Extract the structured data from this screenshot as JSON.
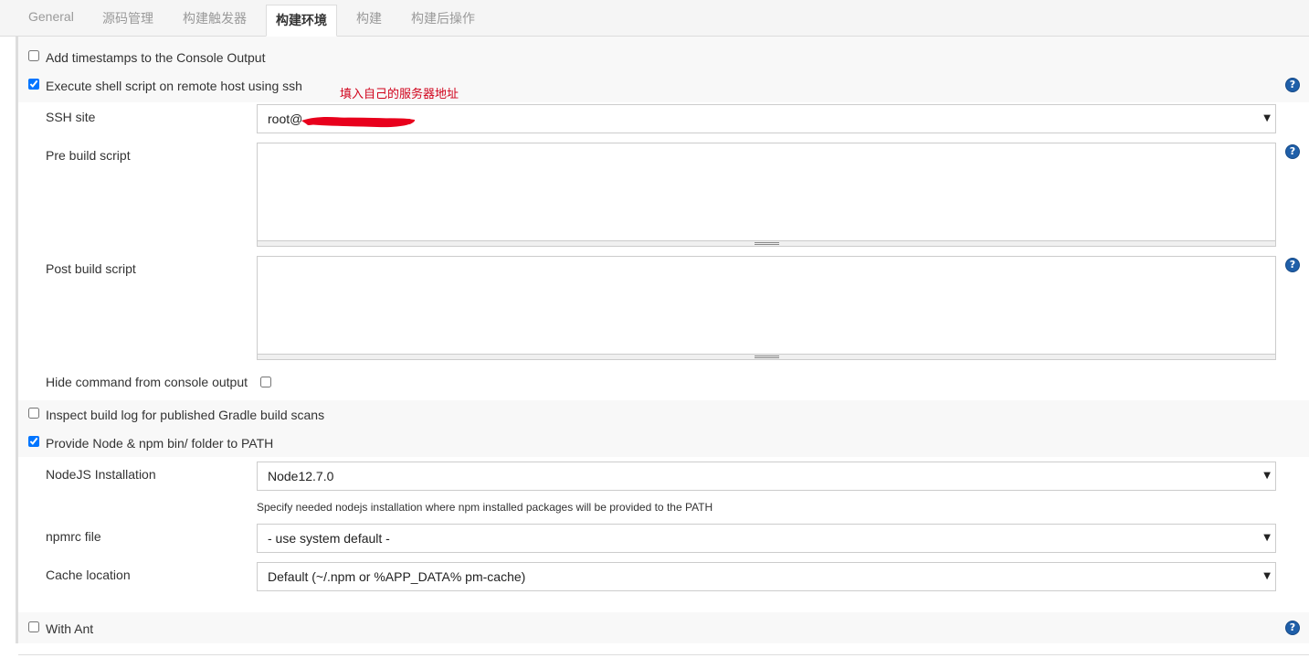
{
  "tabs": [
    {
      "label": "General",
      "active": false
    },
    {
      "label": "源码管理",
      "active": false
    },
    {
      "label": "构建触发器",
      "active": false
    },
    {
      "label": "构建环境",
      "active": true
    },
    {
      "label": "构建",
      "active": false
    },
    {
      "label": "构建后操作",
      "active": false
    }
  ],
  "options": {
    "timestamps": {
      "label": "Add timestamps to the Console Output",
      "checked": false
    },
    "ssh": {
      "label": "Execute shell script on remote host using ssh",
      "checked": true
    },
    "gradle": {
      "label": "Inspect build log for published Gradle build scans",
      "checked": false
    },
    "node": {
      "label": "Provide Node & npm bin/ folder to PATH",
      "checked": true
    },
    "ant": {
      "label": "With Ant",
      "checked": false
    }
  },
  "annotation": "填入自己的服务器地址",
  "ssh_config": {
    "site_label": "SSH site",
    "site_value": "root@",
    "pre_label": "Pre build script",
    "pre_value": "",
    "post_label": "Post build script",
    "post_value": "",
    "hide_label": "Hide command from console output",
    "hide_checked": false
  },
  "node_config": {
    "install_label": "NodeJS Installation",
    "install_value": "Node12.7.0",
    "install_hint": "Specify needed nodejs installation where npm installed packages will be provided to the PATH",
    "npmrc_label": "npmrc file",
    "npmrc_value": "- use system default -",
    "cache_label": "Cache location",
    "cache_value": "Default (~/.npm or %APP_DATA% pm-cache)"
  },
  "help_glyph": "?",
  "dropdown_arrow": "▼",
  "colors": {
    "accent_help": "#1f5fa9",
    "annotation_red": "#d0021b",
    "redaction_red": "#e8001c"
  }
}
